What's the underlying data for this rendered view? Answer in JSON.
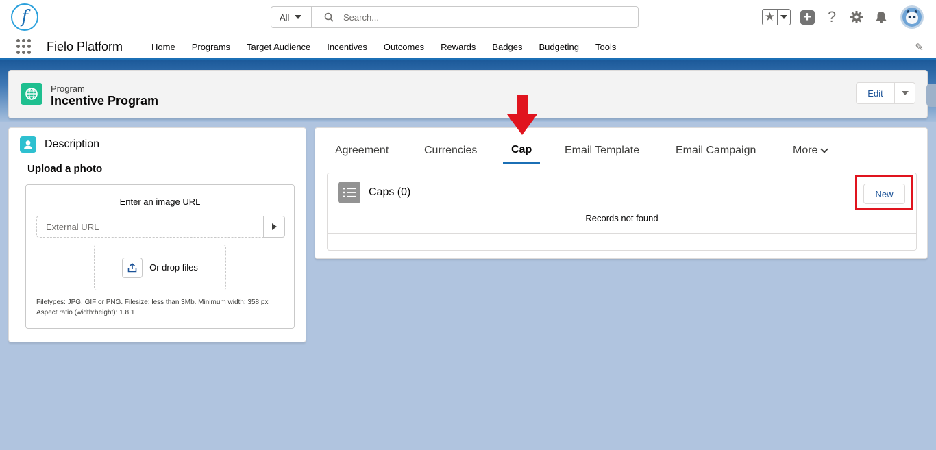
{
  "header": {
    "logo_letter": "f",
    "search": {
      "scope": "All",
      "placeholder": "Search..."
    },
    "icons": [
      "favorites-star-icon",
      "chevron-down-icon",
      "plus-icon",
      "help-icon",
      "gear-icon",
      "bell-icon",
      "avatar"
    ]
  },
  "nav": {
    "app_name": "Fielo Platform",
    "items": [
      "Home",
      "Programs",
      "Target Audience",
      "Incentives",
      "Outcomes",
      "Rewards",
      "Badges",
      "Budgeting",
      "Tools"
    ]
  },
  "record": {
    "type": "Program",
    "title": "Incentive Program",
    "edit_label": "Edit"
  },
  "description": {
    "title": "Description",
    "upload_title": "Upload a photo",
    "url_label": "Enter an image URL",
    "url_placeholder": "External URL",
    "drop_label": "Or drop files",
    "hint_line1": "Filetypes: JPG, GIF or PNG. Filesize: less than 3Mb. Minimum width: 358 px",
    "hint_line2": "Aspect ratio (width:height): 1.8:1"
  },
  "tabs": {
    "items": [
      "Agreement",
      "Currencies",
      "Cap",
      "Email Template",
      "Email Campaign"
    ],
    "more_label": "More",
    "active": "Cap"
  },
  "related": {
    "title": "Caps (0)",
    "new_label": "New",
    "empty_message": "Records not found"
  },
  "colors": {
    "brand": "#1b6fb5",
    "annotation_red": "#e0141e",
    "record_icon": "#1ebf8f",
    "description_icon": "#2ec0d0"
  }
}
